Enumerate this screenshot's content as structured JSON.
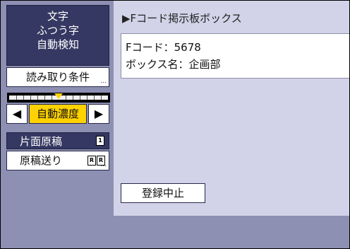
{
  "mode": {
    "line1": "文字",
    "line2": "ふつう字",
    "line3": "自動検知"
  },
  "reading_conditions_label": "読み取り条件",
  "more_indicator": "...",
  "density": {
    "left_arrow": "◀",
    "right_arrow": "▶",
    "auto_label": "自動濃度",
    "level_fraction": 0.5
  },
  "original": {
    "single_sided_label": "片面原稿",
    "feed_label": "原稿送り",
    "single_icon": "single-side-doc-icon",
    "feed_icon": "rotate-doc-icon"
  },
  "box": {
    "title": "▶Fコード掲示板ボックス",
    "fcode_line": "Fコード：5678",
    "boxname_line": "ボックス名：企画部",
    "stop_button": "登録中止"
  },
  "colors": {
    "panel_dark": "#353862",
    "panel_bg": "#8d90b2",
    "content_bg": "#d2d2e8",
    "accent": "#ffd200"
  }
}
